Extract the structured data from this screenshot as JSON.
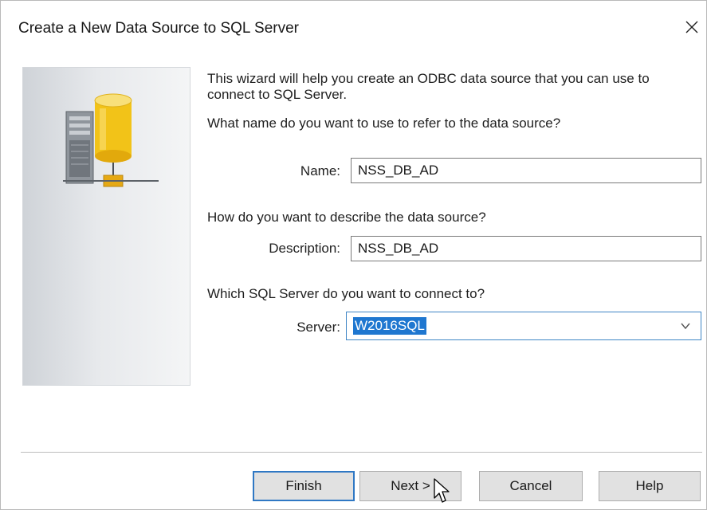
{
  "window": {
    "title": "Create a New Data Source to SQL Server",
    "close_symbol": "✕"
  },
  "intro": {
    "line1": "This wizard will help you create an ODBC data source that you can use to",
    "line2": "connect to SQL Server."
  },
  "name_section": {
    "question": "What name do you want to use to refer to the data source?",
    "label": "Name:",
    "value": "NSS_DB_AD"
  },
  "description_section": {
    "question": "How do you want to describe the data source?",
    "label": "Description:",
    "value": "NSS_DB_AD"
  },
  "server_section": {
    "question": "Which SQL Server do you want to connect to?",
    "label": "Server:",
    "value": "W2016SQL"
  },
  "buttons": {
    "finish": "Finish",
    "next": "Next >",
    "cancel": "Cancel",
    "help": "Help"
  },
  "icons": {
    "graphic": "server-database-network-icon",
    "close": "close-icon",
    "dropdown": "chevron-down-icon",
    "cursor": "mouse-pointer-icon"
  },
  "colors": {
    "selection": "#1f77d0",
    "focus_border": "#3f86c6",
    "default_button_border": "#2f78c4"
  }
}
